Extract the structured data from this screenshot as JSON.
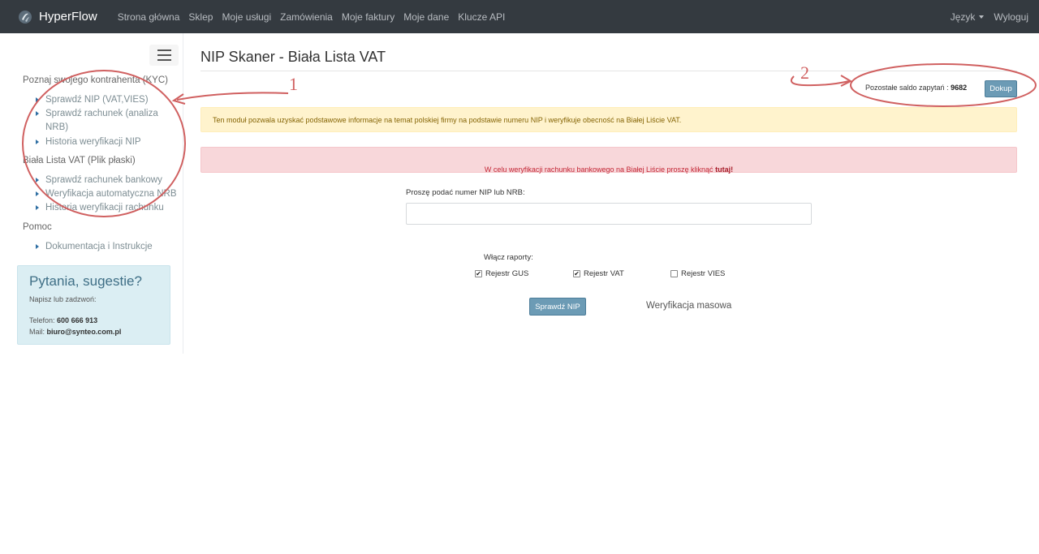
{
  "navbar": {
    "brand": "HyperFlow",
    "links": [
      "Strona główna",
      "Sklep",
      "Moje usługi",
      "Zamówienia",
      "Moje faktury",
      "Moje dane",
      "Klucze API"
    ],
    "language": "Język",
    "logout": "Wyloguj"
  },
  "sidebar": {
    "section1": {
      "title": "Poznaj swojego kontrahenta (KYC)",
      "items": [
        "Sprawdź NIP (VAT,VIES)",
        "Sprawdź rachunek (analiza",
        "NRB)",
        "Historia weryfikacji NIP"
      ]
    },
    "section2": {
      "title": "Biała Lista VAT (Plik płaski)",
      "items": [
        "Sprawdź rachunek bankowy",
        "Weryfikacja automatyczna NRB",
        "Historia weryfikacji rachunku"
      ]
    },
    "section3": {
      "title": "Pomoc",
      "items": [
        "Dokumentacja i Instrukcje"
      ]
    },
    "contact": {
      "title": "Pytania, sugestie?",
      "subtitle": "Napisz lub zadzwoń:",
      "phone_label": "Telefon:",
      "phone": "600 666 913",
      "mail_label": "Mail:",
      "mail": "biuro@synteo.com.pl"
    }
  },
  "main": {
    "title": "NIP Skaner - Biała Lista VAT",
    "balance_label": "Pozostałe saldo zapytań :",
    "balance_value": "9682",
    "topup_button": "Dokup",
    "info_alert": "Ten moduł pozwala uzyskać podstawowe informacje na temat polskiej firmy na podstawie numeru NIP i weryfikuje obecność na Białej Liście VAT.",
    "danger_alert_text": "W celu weryfikacji rachunku bankowego na Białej Liście proszę kliknąć",
    "danger_alert_link": "tutaj!",
    "nip_label": "Proszę podać numer NIP lub NRB:",
    "nip_value": "",
    "reports_label": "Włącz raporty:",
    "reports": [
      {
        "label": "Rejestr GUS",
        "checked": true
      },
      {
        "label": "Rejestr VAT",
        "checked": true
      },
      {
        "label": "Rejestr VIES",
        "checked": false
      }
    ],
    "check_button": "Sprawdź NIP",
    "mass_link": "Weryfikacja masowa"
  },
  "annotations": {
    "num1": "1",
    "num2": "2",
    "color": "#d06060"
  },
  "colors": {
    "navbar": "#343a40",
    "button": "#6c9bb5",
    "warning_bg": "#fff3cd",
    "danger_bg": "#f8d7da",
    "contact_bg": "#dbeef3"
  }
}
